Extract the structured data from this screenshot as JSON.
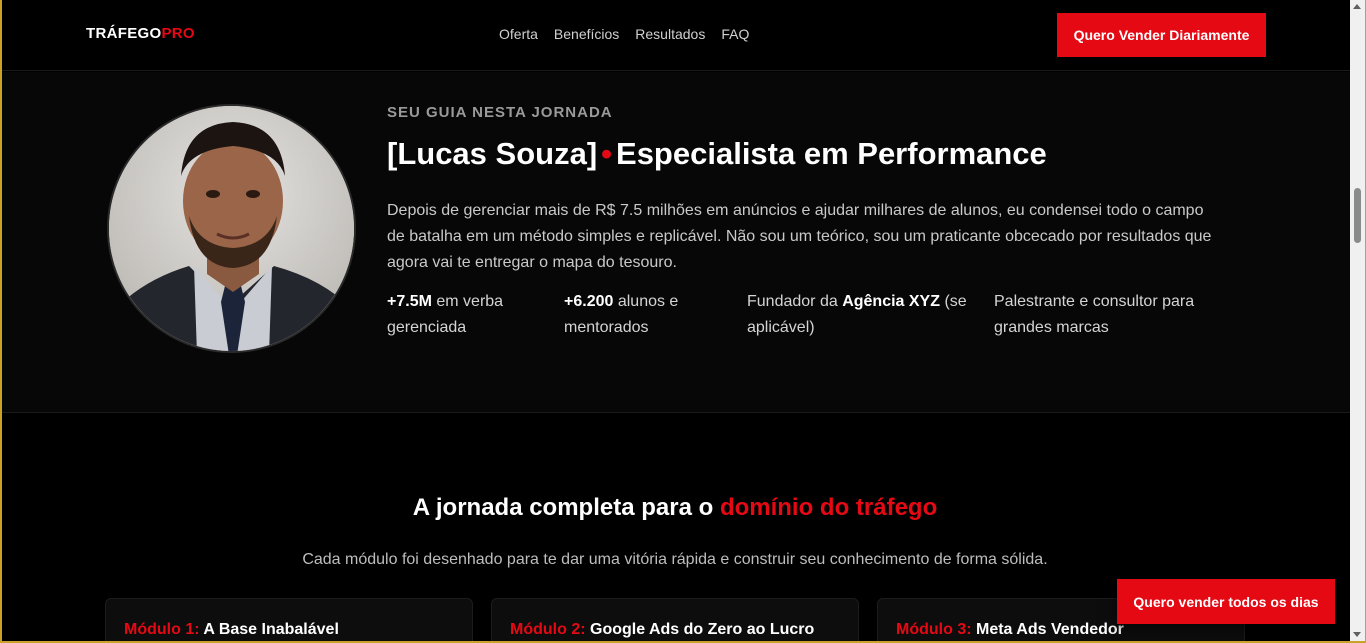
{
  "header": {
    "logo_main": "TRÁFEGO",
    "logo_accent": "PRO",
    "nav": [
      "Oferta",
      "Benefícios",
      "Resultados",
      "FAQ"
    ],
    "cta": "Quero Vender Diariamente"
  },
  "about": {
    "eyebrow": "SEU GUIA NESTA JORNADA",
    "name": "[Lucas Souza]",
    "role": "Especialista em Performance",
    "description": "Depois de gerenciar mais de R$ 7.5 milhões em anúncios e ajudar milhares de alunos, eu condensei todo o campo de batalha em um método simples e replicável. Não sou um teórico, sou um praticante obcecado por resultados que agora vai te entregar o mapa do tesouro.",
    "stats": [
      {
        "strong": "+7.5M",
        "text": " em verba gerenciada"
      },
      {
        "strong": "+6.200",
        "text": " alunos e mentorados"
      },
      {
        "prefix": "Fundador da ",
        "strong": "Agência XYZ",
        "text": " (se aplicável)"
      },
      {
        "text": "Palestrante e consultor para grandes marcas"
      }
    ]
  },
  "journey": {
    "title_prefix": "A jornada completa para o ",
    "title_highlight": "domínio do tráfego",
    "subtitle": "Cada módulo foi desenhado para te dar uma vitória rápida e construir seu conhecimento de forma sólida.",
    "modules": [
      {
        "label": "Módulo 1:",
        "title": "A Base Inabalável"
      },
      {
        "label": "Módulo 2:",
        "title": "Google Ads do Zero ao Lucro"
      },
      {
        "label": "Módulo 3:",
        "title": "Meta Ads Vendedor"
      }
    ]
  },
  "floating_cta": "Quero vender todos os dias",
  "colors": {
    "accent": "#e50914",
    "background": "#000000"
  }
}
